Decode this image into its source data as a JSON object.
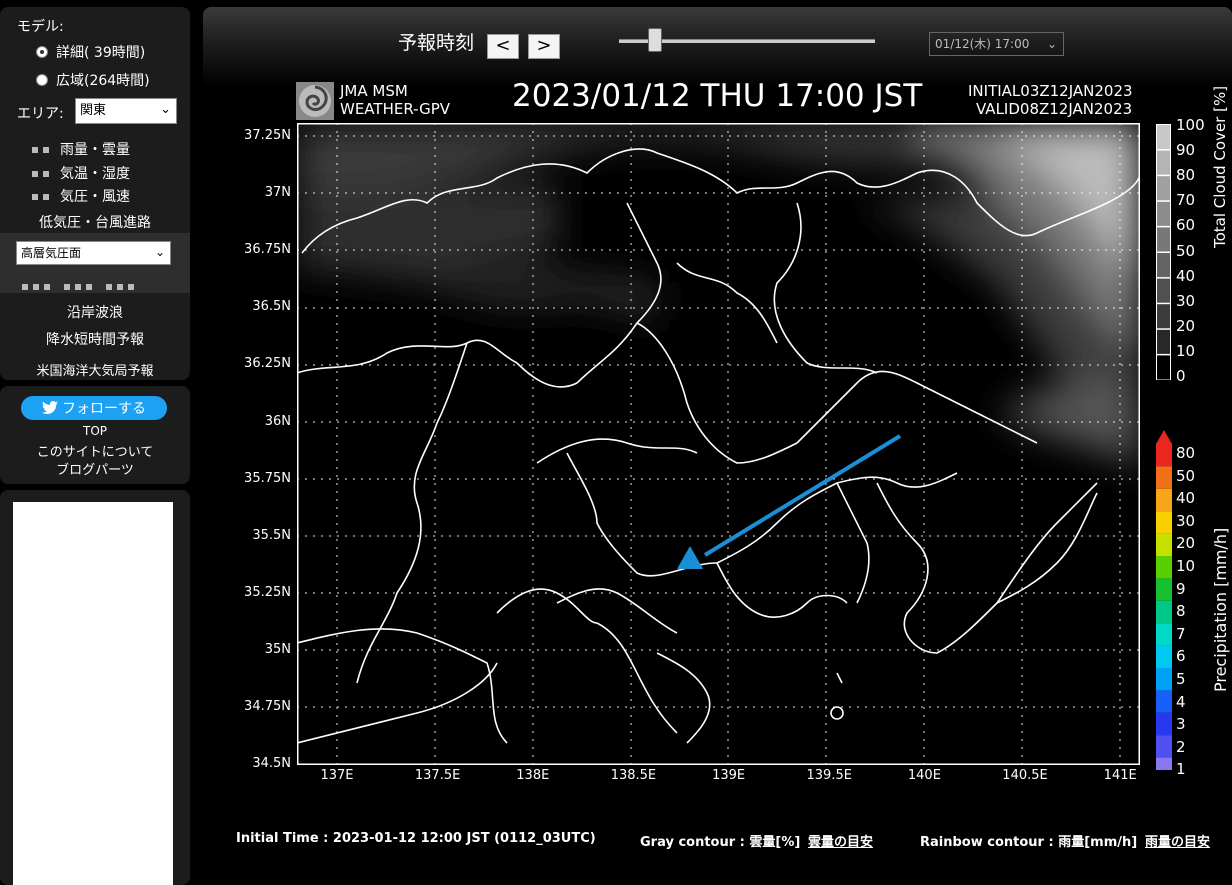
{
  "sidebar": {
    "model_label": "モデル:",
    "models": [
      {
        "label": "詳細(  39時間)",
        "selected": true
      },
      {
        "label": "広域(264時間)",
        "selected": false
      }
    ],
    "area_label": "エリア:",
    "area_value": "関東",
    "menu_items": [
      "雨量・雲量",
      "気温・湿度",
      "気圧・風速"
    ],
    "typhoon": "低気圧・台風進路",
    "upper_select": "高層気圧面",
    "links": [
      "沿岸波浪",
      "降水短時間予報",
      "米国海洋大気局予報"
    ],
    "follow_button": "フォローする",
    "footer_links": [
      "TOP",
      "このサイトについて",
      "ブログパーツ"
    ]
  },
  "header": {
    "forecast_label": "予報時刻",
    "prev": "<",
    "next": ">",
    "time_select": "01/12(木) 17:00",
    "slider_fraction": 0.14
  },
  "map": {
    "brand_line1": "JMA MSM",
    "brand_line2": "WEATHER-GPV",
    "datetime": "2023/01/12 THU  17:00 JST",
    "initial": "INITIAL03Z12JAN2023",
    "valid": "VALID08Z12JAN2023",
    "lat_labels": [
      "37.25N",
      "37N",
      "36.75N",
      "36.5N",
      "36.25N",
      "36N",
      "35.75N",
      "35.5N",
      "35.25N",
      "35N",
      "34.75N",
      "34.5N"
    ],
    "lon_labels": [
      "137E",
      "137.5E",
      "138E",
      "138.5E",
      "139E",
      "139.5E",
      "140E",
      "140.5E",
      "141E"
    ],
    "cloud_scale_title": "Total Cloud Cover [%]",
    "cloud_scale": [
      "100",
      "90",
      "80",
      "70",
      "60",
      "50",
      "40",
      "30",
      "20",
      "10",
      "0"
    ],
    "precip_scale_title": "Precipitation [mm/h]",
    "precip_scale": [
      "80",
      "50",
      "40",
      "30",
      "20",
      "10",
      "9",
      "8",
      "7",
      "6",
      "5",
      "4",
      "3",
      "2",
      "1"
    ],
    "precip_colors": [
      "#e8281e",
      "#f07018",
      "#f8a418",
      "#f8d000",
      "#c8e000",
      "#58d000",
      "#18c030",
      "#00c888",
      "#00d8c8",
      "#00c8f0",
      "#00a0f8",
      "#1860f8",
      "#2838f0",
      "#5050f0",
      "#8878f0"
    ],
    "accent": "#1a8fd6"
  },
  "footer": {
    "initial_time": "Initial Time : 2023-01-12 12:00 JST (0112_03UTC)",
    "gray_contour": "Gray contour : 雲量[%]",
    "gray_link": "雲量の目安",
    "rainbow_contour": "Rainbow contour : 雨量[mm/h]",
    "rainbow_link": "雨量の目安"
  }
}
